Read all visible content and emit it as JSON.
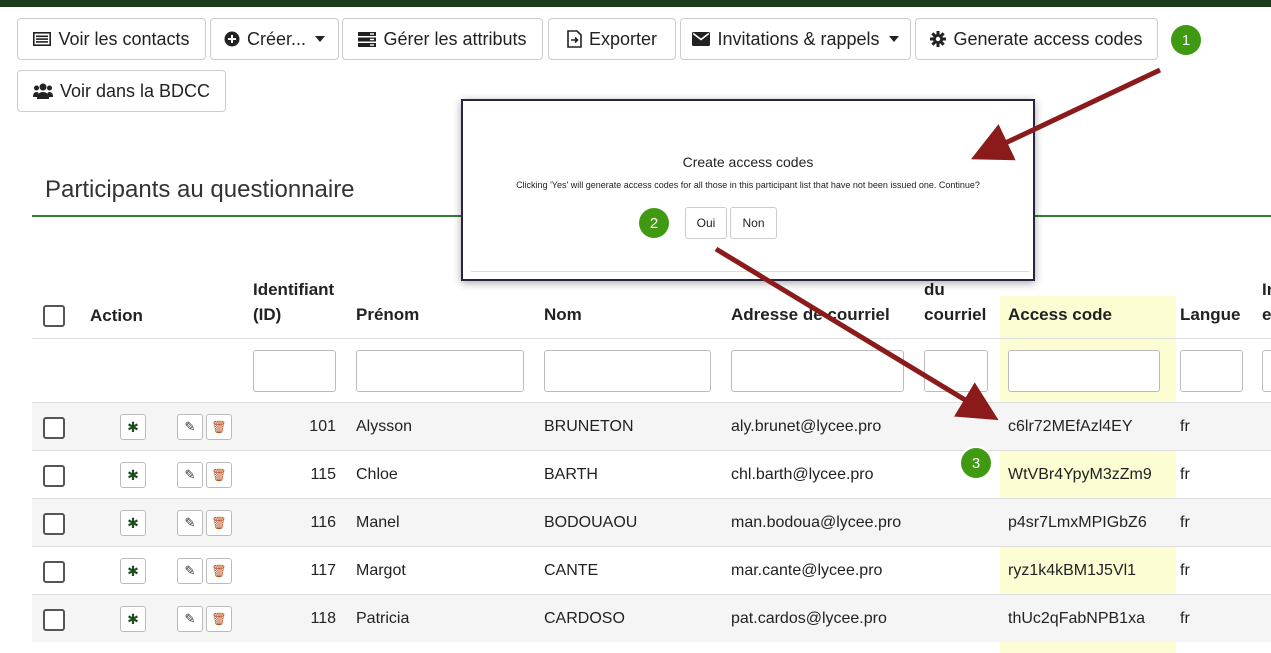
{
  "toolbar": {
    "view_contacts": "Voir les contacts",
    "create": "Créer...",
    "manage_attributes": "Gérer les attributs",
    "export": "Exporter",
    "invitations": "Invitations & rappels",
    "generate_codes": "Generate access codes",
    "view_bdcc": "Voir dans la BDCC"
  },
  "page": {
    "title": "Participants au questionnaire"
  },
  "table": {
    "headers": {
      "action": "Action",
      "id_line1": "Identifiant",
      "id_line2": "(ID)",
      "firstname": "Prénom",
      "lastname": "Nom",
      "email": "Adresse de courriel",
      "email2_line1": "du",
      "email2_line2": "courriel",
      "access_code": "Access code",
      "language": "Langue",
      "extra_line1": "In",
      "extra_line2": "e"
    },
    "rows": [
      {
        "id": "101",
        "firstname": "Alysson",
        "lastname": "BRUNETON",
        "email": "aly.brunet@lycee.pro",
        "access_code": "c6lr72MEfAzl4EY",
        "language": "fr"
      },
      {
        "id": "115",
        "firstname": "Chloe",
        "lastname": "BARTH",
        "email": "chl.barth@lycee.pro",
        "access_code": "WtVBr4YpyM3zZm9",
        "language": "fr"
      },
      {
        "id": "116",
        "firstname": "Manel",
        "lastname": "BODOUAOU",
        "email": "man.bodoua@lycee.pro",
        "access_code": "p4sr7LmxMPIGbZ6",
        "language": "fr"
      },
      {
        "id": "117",
        "firstname": "Margot",
        "lastname": "CANTE",
        "email": "mar.cante@lycee.pro",
        "access_code": "ryz1k4kBM1J5Vl1",
        "language": "fr"
      },
      {
        "id": "118",
        "firstname": "Patricia",
        "lastname": "CARDOSO",
        "email": "pat.cardos@lycee.pro",
        "access_code": "thUc2qFabNPB1xa",
        "language": "fr"
      }
    ]
  },
  "modal": {
    "title": "Create access codes",
    "text": "Clicking 'Yes' will generate access codes for all those in this participant list that have not been issued one. Continue?",
    "yes": "Oui",
    "no": "Non"
  },
  "annotations": {
    "step1": "1",
    "step2": "2",
    "step3": "3"
  },
  "colors": {
    "accent_green": "#3f9a11",
    "top_bar": "#1d3b1d",
    "arrow": "#8b1a1a",
    "access_highlight": "#fdfdd4"
  },
  "icons": {
    "view_contacts": "list-icon",
    "create": "plus-circle-icon",
    "manage_attributes": "server-icon",
    "export": "file-export-icon",
    "invitations": "envelope-icon",
    "generate_codes": "gear-icon",
    "view_bdcc": "users-icon"
  }
}
